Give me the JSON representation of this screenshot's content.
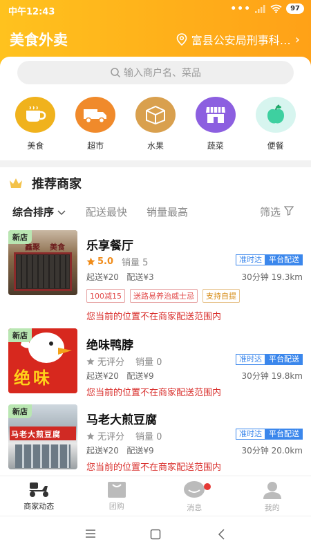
{
  "status_bar": {
    "time": "中午12:43",
    "battery": "97"
  },
  "header": {
    "title": "美食外卖",
    "location": "富县公安局刑事科…"
  },
  "search": {
    "placeholder": "输入商户名、菜品"
  },
  "categories": [
    {
      "label": "美食",
      "icon": "coffee-cup-icon",
      "color": "#f0b21d"
    },
    {
      "label": "超市",
      "icon": "delivery-truck-icon",
      "color": "#f08a2b"
    },
    {
      "label": "水果",
      "icon": "box-icon",
      "color": "#d9a04e"
    },
    {
      "label": "蔬菜",
      "icon": "storefront-icon",
      "color": "#8c5fe0"
    },
    {
      "label": "便餐",
      "icon": "apple-icon",
      "color": "#3ed0c5"
    }
  ],
  "section": {
    "title": "推荐商家"
  },
  "sort": {
    "comprehensive": "综合排序",
    "fastest": "配送最快",
    "sales": "销量最高",
    "filter": "筛选"
  },
  "stores": [
    {
      "new_tag": "新店",
      "name": "乐享餐厅",
      "score": "5.0",
      "sales": "销量 5",
      "badge_ontime": "准时达",
      "badge_platform": "平台配送",
      "min_order": "起送¥20",
      "delivery_fee": "配送¥3",
      "eta": "30分钟 19.3km",
      "tags": [
        "100减15",
        "送路易养治威士忌",
        "支持自提"
      ],
      "warning": "您当前的位置不在商家配送范围内",
      "thumb_text": "鑫聚",
      "thumb_sub": "美食"
    },
    {
      "new_tag": "新店",
      "name": "绝味鸭脖",
      "rating": "无评分",
      "sales": "销量 0",
      "badge_ontime": "准时达",
      "badge_platform": "平台配送",
      "min_order": "起送¥20",
      "delivery_fee": "配送¥9",
      "eta": "30分钟 19.8km",
      "warning": "您当前的位置不在商家配送范围内",
      "thumb_text": "绝味"
    },
    {
      "new_tag": "新店",
      "name": "马老大煎豆腐",
      "rating": "无评分",
      "sales": "销量 0",
      "badge_ontime": "准时达",
      "badge_platform": "平台配送",
      "min_order": "起送¥20",
      "delivery_fee": "配送¥9",
      "eta": "30分钟 20.0km",
      "warning": "您当前的位置不在商家配送范围内",
      "thumb_text": "马老大煎豆腐"
    }
  ],
  "tabs": [
    {
      "label": "商家动态",
      "icon": "scooter-icon",
      "active": true
    },
    {
      "label": "团购",
      "icon": "shopping-bag-icon"
    },
    {
      "label": "消息",
      "icon": "chat-bubble-icon"
    },
    {
      "label": "我的",
      "icon": "user-icon"
    }
  ],
  "colors": {
    "brand": "#ffb31a",
    "accent_blue": "#3b87ec",
    "warning_red": "#d9302d"
  }
}
